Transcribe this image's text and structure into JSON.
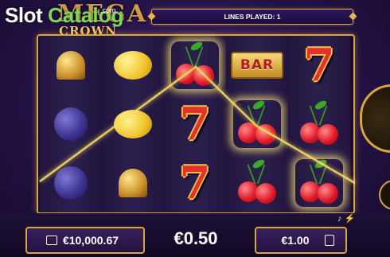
{
  "watermark": {
    "slot": "Slot",
    "catalog": "Catalog",
    "com": ".com"
  },
  "game_logo": {
    "top": "MEGA",
    "bottom": "CROWN"
  },
  "header": {
    "lines_played": "LINES PLAYED: 1"
  },
  "reels": [
    [
      "bell",
      "plum",
      "plum"
    ],
    [
      "lemon",
      "lemon",
      "bell"
    ],
    [
      "cherry",
      "seven",
      "seven"
    ],
    [
      "bar",
      "cherry",
      "cherry"
    ],
    [
      "seven",
      "cherry",
      "cherry"
    ]
  ],
  "winning_symbols": [
    "cherry"
  ],
  "footer": {
    "balance": "€10,000.67",
    "win": "€0.50",
    "bet": "€1.00"
  },
  "colors": {
    "accent": "#d9a63c",
    "payline": "#f5e06a"
  },
  "icons": {
    "balance": "wallet-icon",
    "bet": "coins-icon",
    "sound": "music-note-icon",
    "turbo": "lightning-icon"
  }
}
